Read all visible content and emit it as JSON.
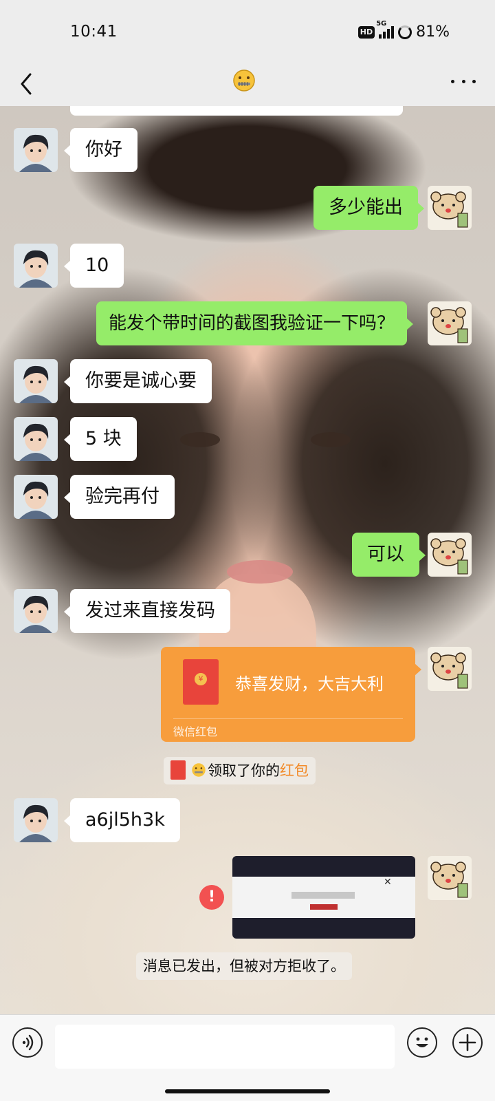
{
  "status_bar": {
    "time": "10:41",
    "hd_label": "HD",
    "network": "5G",
    "battery": "81%"
  },
  "nav": {
    "title_icon": "zipper-mouth-emoji",
    "back_icon": "chevron-left-icon",
    "more_icon": "more-dots-icon"
  },
  "messages": [
    {
      "side": "left",
      "text": "你好"
    },
    {
      "side": "right",
      "text": "多少能出"
    },
    {
      "side": "left",
      "text": "10"
    },
    {
      "side": "right",
      "text": "能发个带时间的截图我验证一下吗？"
    },
    {
      "side": "left",
      "text": "你要是诚心要"
    },
    {
      "side": "left",
      "text": "5 块"
    },
    {
      "side": "left",
      "text": "验完再付"
    },
    {
      "side": "right",
      "text": "可以"
    },
    {
      "side": "left",
      "text": "发过来直接发码"
    },
    {
      "side": "left",
      "text": "a6jl5h3k"
    }
  ],
  "red_packet": {
    "greeting": "恭喜发财，大吉大利",
    "footer": "微信红包",
    "coin_symbol": "¥"
  },
  "red_packet_note": {
    "prefix": "领取了你的",
    "highlight": "红包"
  },
  "error_icon": "!",
  "rejected_note": "消息已发出，但被对方拒收了。",
  "colors": {
    "sent_bubble": "#95ec69",
    "received_bubble": "#ffffff",
    "red_packet": "#f79d3c",
    "error": "#f25151"
  }
}
